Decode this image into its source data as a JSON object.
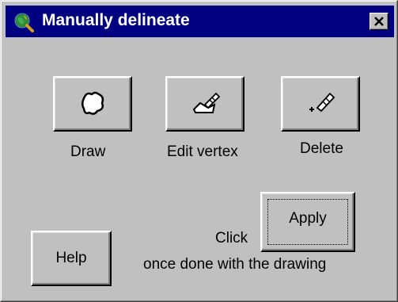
{
  "window": {
    "title": "Manually delineate",
    "title_icon": "globe-magnifier-icon",
    "close_icon": "close-icon"
  },
  "tools": {
    "draw": {
      "label": "Draw",
      "icon": "polygon-blob-icon"
    },
    "edit_vertex": {
      "label": "Edit vertex",
      "icon": "edit-vertex-pen-icon"
    },
    "delete": {
      "label": "Delete",
      "icon": "delete-vertex-pen-icon"
    }
  },
  "actions": {
    "help_label": "Help",
    "apply_label": "Apply",
    "click_text": "Click",
    "instruction_text": "once done with the drawing"
  },
  "colors": {
    "titlebar": "#000080",
    "face": "#c0c0c0"
  }
}
